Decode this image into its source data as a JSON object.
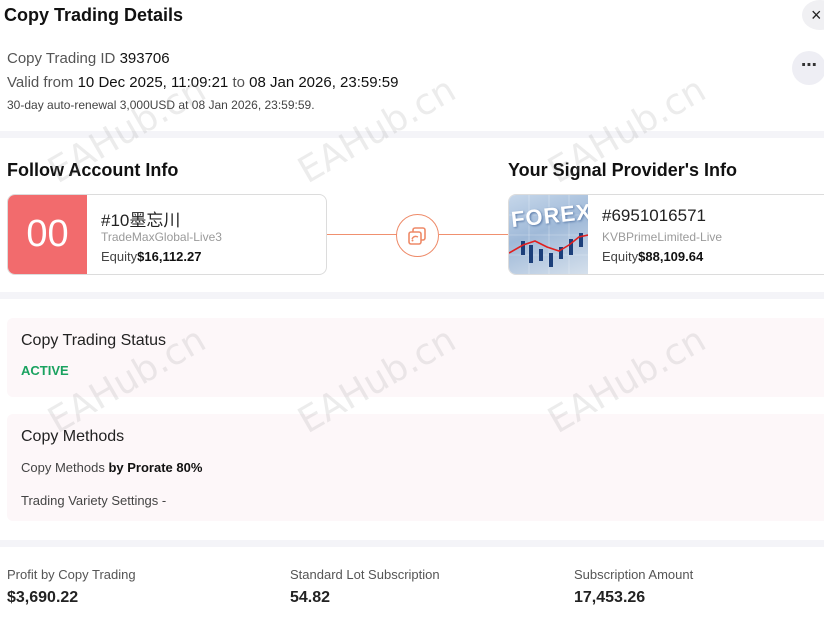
{
  "header": {
    "title": "Copy Trading Details",
    "close_icon": "×"
  },
  "info": {
    "id_label": "Copy Trading ID",
    "id_value": "393706",
    "valid_label": "Valid from",
    "valid_from": "10 Dec 2025, 11:09:21",
    "valid_to_label": "to",
    "valid_to": "08 Jan 2026, 23:59:59",
    "renewal": "30-day auto-renewal 3,000USD at 08 Jan 2026, 23:59:59.",
    "more_icon": "⋯"
  },
  "follow": {
    "title": "Follow Account Info",
    "avatar": "00",
    "id": "#10墨忘川",
    "server": "TradeMaxGlobal-Live3",
    "equity_label": "Equity",
    "equity_value": "$16,112.27"
  },
  "provider": {
    "title": "Your Signal Provider's Info",
    "image_text": "FOREX",
    "id": "#6951016571",
    "server": "KVBPrimeLimited-Live",
    "equity_label": "Equity",
    "equity_value": "$88,109.64"
  },
  "status": {
    "title": "Copy Trading Status",
    "value": "ACTIVE",
    "color": "#1aa260"
  },
  "methods": {
    "title": "Copy Methods",
    "method_label": "Copy Methods",
    "method_value": "by Prorate 80%",
    "variety_label": "Trading Variety Settings",
    "variety_value": "-"
  },
  "stats": [
    {
      "label": "Profit by Copy Trading",
      "value": "$3,690.22"
    },
    {
      "label": "Standard Lot Subscription",
      "value": "54.82"
    },
    {
      "label": "Subscription Amount",
      "value": "17,453.26"
    }
  ],
  "watermark": "EAHub.cn",
  "colors": {
    "accent": "#f26b6d",
    "link": "#ee8a68",
    "active": "#1aa260"
  }
}
